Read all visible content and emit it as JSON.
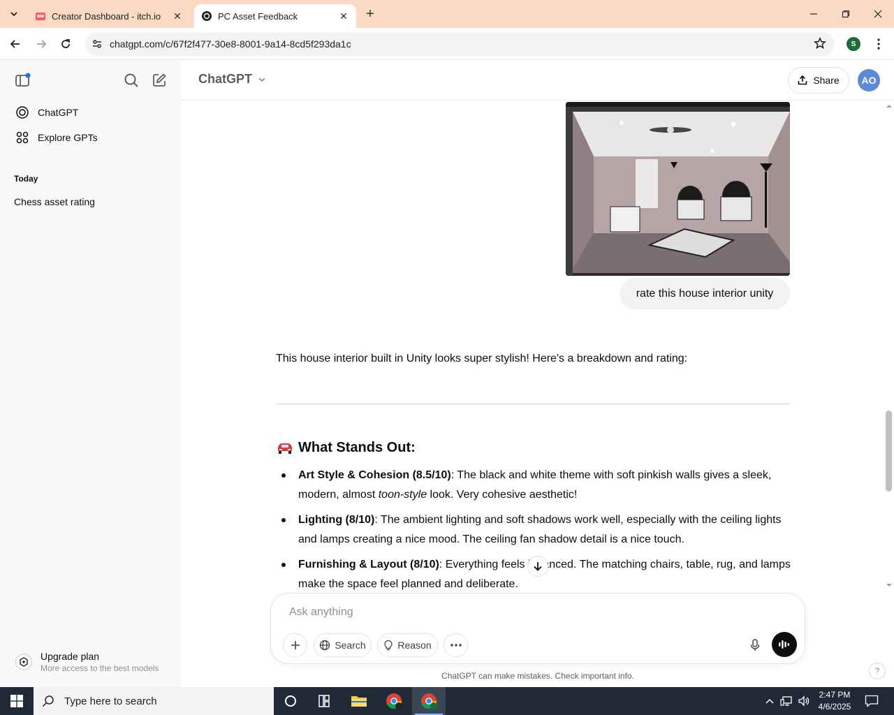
{
  "browser": {
    "tabs": [
      {
        "title": "Creator Dashboard - itch.io",
        "active": false
      },
      {
        "title": "PC Asset Feedback",
        "active": true
      }
    ],
    "url": "chatgpt.com/c/67f2f477-30e8-8001-9a14-8cd5f293da1c",
    "profile_initial": "S"
  },
  "sidebar": {
    "items": [
      {
        "label": "ChatGPT",
        "icon": "openai-logo-icon"
      },
      {
        "label": "Explore GPTs",
        "icon": "grid-icon"
      }
    ],
    "section_today": "Today",
    "chats": [
      "Chess asset rating"
    ],
    "upgrade": {
      "title": "Upgrade plan",
      "subtitle": "More access to the best models"
    }
  },
  "header": {
    "model": "ChatGPT",
    "share_label": "Share",
    "avatar_initials": "AO"
  },
  "conversation": {
    "user_message": "rate this house interior unity",
    "assistant_intro": "This house interior built in Unity looks super stylish! Here's a breakdown and rating:",
    "section_title": "What Stands Out:",
    "bullets": [
      {
        "bold": "Art Style & Cohesion (8.5/10)",
        "pre": ": The black and white theme with soft pinkish walls gives a sleek, modern, almost ",
        "italic": "toon-style",
        "post": " look. Very cohesive aesthetic!"
      },
      {
        "bold": "Lighting (8/10)",
        "pre": ": The ambient lighting and soft shadows work well, especially with the ceiling lights and lamps creating a nice mood. The ceiling fan shadow detail is a nice touch.",
        "italic": "",
        "post": ""
      },
      {
        "bold": "Furnishing & Layout (8/10)",
        "pre": ": Everything feels balanced. The matching chairs, table, rug, and lamps make the space feel planned and deliberate.",
        "italic": "",
        "post": ""
      }
    ]
  },
  "composer": {
    "placeholder": "Ask anything",
    "search_label": "Search",
    "reason_label": "Reason",
    "disclaimer": "ChatGPT can make mistakes. Check important info.",
    "help": "?"
  },
  "taskbar": {
    "search_placeholder": "Type here to search",
    "time": "2:47 PM",
    "date": "4/6/2025"
  },
  "colors": {
    "tabstrip": "#fcd9c2",
    "sidebar": "#f9f9f9",
    "taskbar": "#1f2a36",
    "avatar": "#5b8bd6"
  }
}
